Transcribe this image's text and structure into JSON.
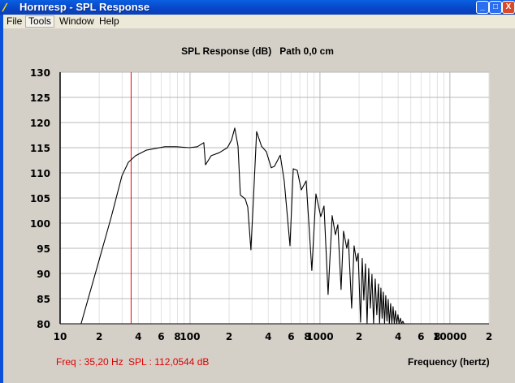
{
  "window": {
    "title": "Hornresp - SPL Response",
    "minimize_label": "_",
    "maximize_label": "□",
    "close_label": "X"
  },
  "menu": [
    "File",
    "Tools",
    "Window",
    "Help"
  ],
  "readout": {
    "freq": "Freq : 35,20 Hz",
    "spl": "SPL : 112,0544 dB"
  },
  "chart_data": {
    "type": "line",
    "title": "SPL Response (dB)   Path 0,0 cm",
    "xlabel": "Frequency (hertz)",
    "ylabel": "",
    "xscale": "log",
    "xlim": [
      10,
      20000
    ],
    "ylim": [
      80,
      130
    ],
    "grid": true,
    "yticks": [
      80,
      85,
      90,
      95,
      100,
      105,
      110,
      115,
      120,
      125,
      130
    ],
    "xticks": [
      {
        "value": 10,
        "label": "10"
      },
      {
        "value": 20,
        "label": "2"
      },
      {
        "value": 40,
        "label": "4"
      },
      {
        "value": 60,
        "label": "6"
      },
      {
        "value": 80,
        "label": "8"
      },
      {
        "value": 100,
        "label": "100"
      },
      {
        "value": 200,
        "label": "2"
      },
      {
        "value": 400,
        "label": "4"
      },
      {
        "value": 600,
        "label": "6"
      },
      {
        "value": 800,
        "label": "8"
      },
      {
        "value": 1000,
        "label": "1000"
      },
      {
        "value": 2000,
        "label": "2"
      },
      {
        "value": 4000,
        "label": "4"
      },
      {
        "value": 6000,
        "label": "6"
      },
      {
        "value": 8000,
        "label": "8"
      },
      {
        "value": 10000,
        "label": "10000"
      },
      {
        "value": 20000,
        "label": "2"
      }
    ],
    "cursor": {
      "freq": 35.2,
      "spl": 112.0544,
      "color": "#ff0000"
    },
    "series": [
      {
        "name": "SPL",
        "color": "#000000",
        "points": [
          [
            14.5,
            80.0
          ],
          [
            20.2,
            93.1
          ],
          [
            24.8,
            101.3
          ],
          [
            29.9,
            109.4
          ],
          [
            33.5,
            112.1
          ],
          [
            38.1,
            113.4
          ],
          [
            46.0,
            114.5
          ],
          [
            64.0,
            115.2
          ],
          [
            78.3,
            115.2
          ],
          [
            98.6,
            115.0
          ],
          [
            113.8,
            115.2
          ],
          [
            127.7,
            116.0
          ],
          [
            131.5,
            111.6
          ],
          [
            145.4,
            113.4
          ],
          [
            167.9,
            114.0
          ],
          [
            193.9,
            115.0
          ],
          [
            208.4,
            116.5
          ],
          [
            220.8,
            118.9
          ],
          [
            233.9,
            115.3
          ],
          [
            244.1,
            105.6
          ],
          [
            266.1,
            104.8
          ],
          [
            277.9,
            103.2
          ],
          [
            294.3,
            94.7
          ],
          [
            307.3,
            104.5
          ],
          [
            325.5,
            118.2
          ],
          [
            354.8,
            115.3
          ],
          [
            386.7,
            114.2
          ],
          [
            421.7,
            111.0
          ],
          [
            446.7,
            111.3
          ],
          [
            494.3,
            113.5
          ],
          [
            530.9,
            108.4
          ],
          [
            587.5,
            95.5
          ],
          [
            622.3,
            110.8
          ],
          [
            668.3,
            110.5
          ],
          [
            718.0,
            106.6
          ],
          [
            782.6,
            108.4
          ],
          [
            866.0,
            90.6
          ],
          [
            930.6,
            105.8
          ],
          [
            1014,
            101.3
          ],
          [
            1074,
            103.4
          ],
          [
            1155,
            85.8
          ],
          [
            1241,
            101.5
          ],
          [
            1315,
            97.7
          ],
          [
            1373,
            99.7
          ],
          [
            1454,
            86.8
          ],
          [
            1518,
            98.4
          ],
          [
            1608,
            95.0
          ],
          [
            1655,
            96.8
          ],
          [
            1753,
            83.1
          ],
          [
            1830,
            95.5
          ],
          [
            1910,
            92.4
          ],
          [
            1967,
            94.0
          ],
          [
            2054,
            80.3
          ],
          [
            2113,
            93.0
          ],
          [
            2175,
            84.7
          ],
          [
            2239,
            91.9
          ],
          [
            2305,
            80.0
          ],
          [
            2371,
            91.0
          ],
          [
            2441,
            83.1
          ],
          [
            2512,
            89.8
          ],
          [
            2585,
            80.0
          ],
          [
            2661,
            88.9
          ],
          [
            2738,
            81.8
          ],
          [
            2818,
            87.9
          ],
          [
            2877,
            80.0
          ],
          [
            2944,
            87.1
          ],
          [
            3006,
            81.1
          ],
          [
            3073,
            86.3
          ],
          [
            3140,
            80.0
          ],
          [
            3207,
            85.6
          ],
          [
            3279,
            80.5
          ],
          [
            3350,
            84.8
          ],
          [
            3420,
            80.0
          ],
          [
            3499,
            84.0
          ],
          [
            3573,
            80.0
          ],
          [
            3652,
            83.4
          ],
          [
            3733,
            80.0
          ],
          [
            3811,
            82.6
          ],
          [
            3899,
            80.0
          ],
          [
            3981,
            81.8
          ],
          [
            4064,
            80.0
          ],
          [
            4159,
            81.1
          ],
          [
            4246,
            80.0
          ],
          [
            4341,
            80.5
          ],
          [
            4436,
            80.0
          ]
        ]
      }
    ]
  }
}
